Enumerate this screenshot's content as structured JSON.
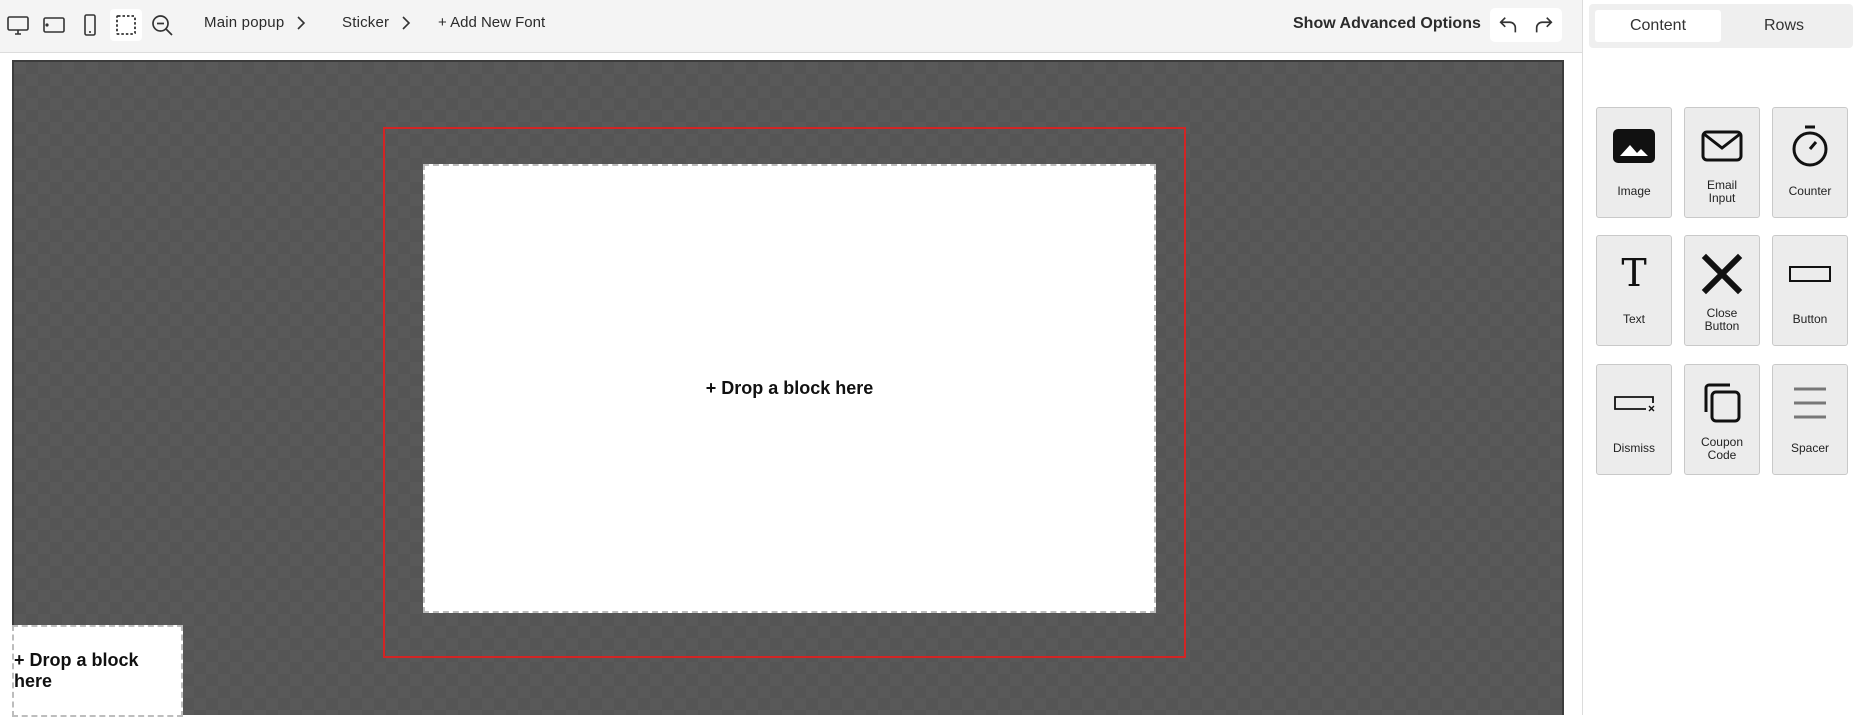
{
  "toolbar": {
    "view_modes": [
      {
        "name": "desktop-view-icon"
      },
      {
        "name": "tablet-view-icon"
      },
      {
        "name": "mobile-view-icon"
      },
      {
        "name": "select-area-icon"
      },
      {
        "name": "zoom-out-icon"
      }
    ],
    "breadcrumbs": [
      {
        "label": "Main popup"
      },
      {
        "label": "Sticker"
      }
    ],
    "add_font_label": "+ Add New Font",
    "advanced_label": "Show Advanced Options"
  },
  "canvas": {
    "main_drop_label": "+ Drop a block here",
    "sticker_drop_label": "+ Drop a block here",
    "frame_color": "#d32424"
  },
  "panel": {
    "tabs": [
      {
        "label": "Content",
        "active": true
      },
      {
        "label": "Rows",
        "active": false
      }
    ],
    "blocks": [
      {
        "label": "Image",
        "icon": "image-icon"
      },
      {
        "label": "Email Input",
        "icon": "envelope-icon"
      },
      {
        "label": "Counter",
        "icon": "stopwatch-icon"
      },
      {
        "label": "Text",
        "icon": "text-icon"
      },
      {
        "label": "Close Button",
        "icon": "close-icon"
      },
      {
        "label": "Button",
        "icon": "button-icon"
      },
      {
        "label": "Dismiss",
        "icon": "dismiss-icon"
      },
      {
        "label": "Coupon Code",
        "icon": "copy-icon"
      },
      {
        "label": "Spacer",
        "icon": "spacer-icon"
      }
    ]
  }
}
